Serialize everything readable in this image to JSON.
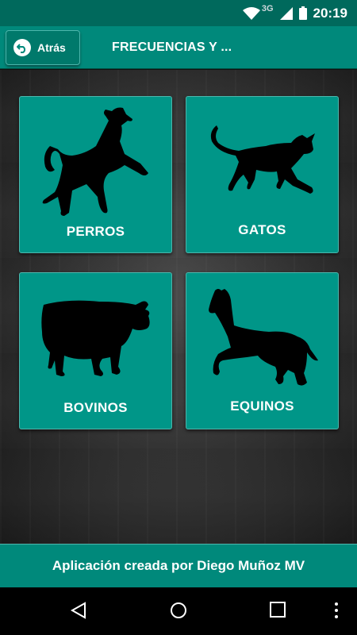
{
  "status_bar": {
    "network": "3G",
    "time": "20:19",
    "icons": [
      "wifi-icon",
      "signal-icon",
      "battery-icon"
    ]
  },
  "app_bar": {
    "back_label": "Atrás",
    "title": "FRECUENCIAS Y ..."
  },
  "tiles": [
    {
      "label": "PERROS",
      "icon": "dog-icon"
    },
    {
      "label": "GATOS",
      "icon": "cat-icon"
    },
    {
      "label": "BOVINOS",
      "icon": "cow-icon"
    },
    {
      "label": "EQUINOS",
      "icon": "horse-icon"
    }
  ],
  "footer": {
    "text": "Aplicación creada por Diego Muñoz MV"
  },
  "nav_bar": {
    "buttons": [
      "back-nav-icon",
      "home-nav-icon",
      "recents-nav-icon",
      "menu-nav-icon"
    ]
  },
  "colors": {
    "primary": "#00897b",
    "primary_dark": "#00695c",
    "tile": "#009688",
    "tile_border": "#4db6ac",
    "background": "#2e2e2e"
  }
}
